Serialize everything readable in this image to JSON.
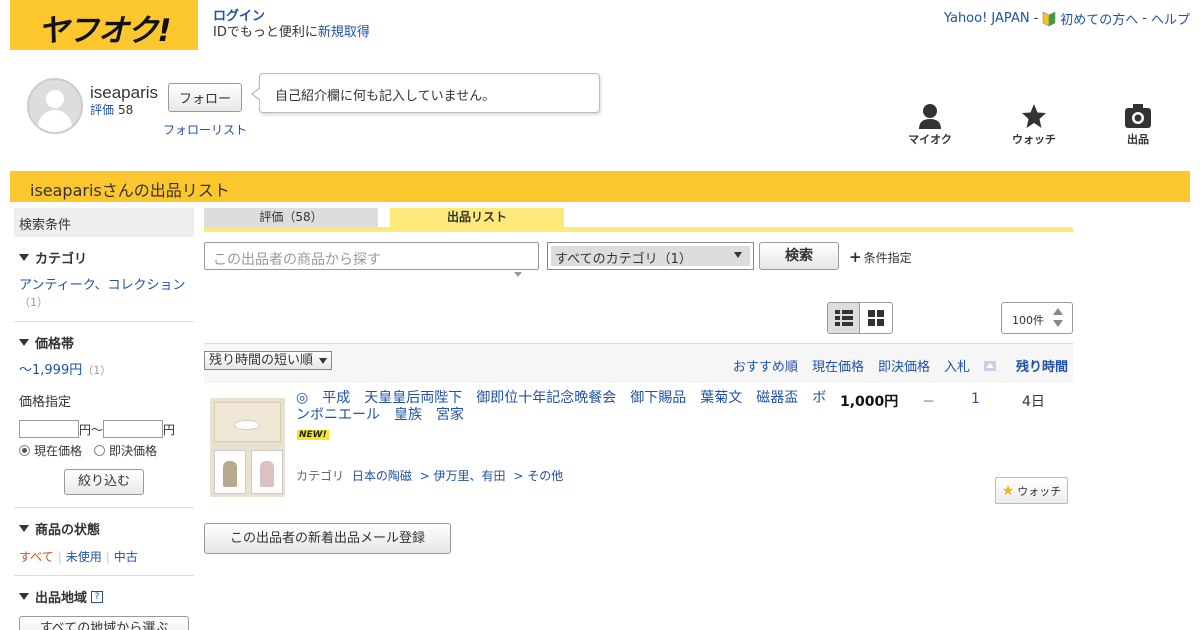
{
  "header": {
    "logo_text": "ヤフオク!",
    "login": "ログイン",
    "login_sub_prefix": "IDでもっと便利に",
    "signup": "新規取得",
    "links": [
      "Yahoo! JAPAN",
      "初めての方へ",
      "ヘルプ"
    ],
    "separator": "-"
  },
  "profile": {
    "username": "iseaparis",
    "rating_label": "評価",
    "rating_value": "58",
    "follow_button": "フォロー",
    "follow_list": "フォローリスト",
    "bio": "自己紹介欄に何も記入していません。"
  },
  "shortcuts": {
    "myauction": "マイオク",
    "watch": "ウォッチ",
    "sell": "出品"
  },
  "title_bar": "iseaparisさんの出品リスト",
  "sidebar": {
    "heading": "検索条件",
    "category_title": "カテゴリ",
    "category_item": "アンティーク、コレクション",
    "category_count": "（1）",
    "price_title": "価格帯",
    "price_range": "〜1,999円",
    "price_count": "（1）",
    "price_spec_label": "価格指定",
    "yen_tilde": "円～",
    "yen": "円",
    "radio_current": "現在価格",
    "radio_buynow": "即決価格",
    "narrow_button": "絞り込む",
    "condition_title": "商品の状態",
    "condition_options": [
      "すべて",
      "未使用",
      "中古"
    ],
    "region_title": "出品地域",
    "region_help": "?",
    "region_button": "すべての地域から選ぶ"
  },
  "tabs": {
    "evaluation": "評価（58）",
    "listing": "出品リスト"
  },
  "search": {
    "placeholder": "この出品者の商品から探す",
    "category_select": "すべてのカテゴリ（1）",
    "button": "検索",
    "condition_spec": "条件指定",
    "condition_plus": "+"
  },
  "per_page": "100件",
  "sort": {
    "select": "残り時間の短い順",
    "links": [
      "おすすめ順",
      "現在価格",
      "即決価格",
      "入札"
    ],
    "active": "残り時間"
  },
  "item": {
    "title": "◎　平成　天皇皇后両陛下　御即位十年記念晩餐会　御下賜品　葉菊文　磁器盃　ボンボニエール　皇族　宮家",
    "badge": "NEW!",
    "category_label": "カテゴリ",
    "category_path": [
      "日本の陶磁",
      "> 伊万里、有田",
      "> その他"
    ],
    "price": "1,000円",
    "buynow": "－",
    "bids": "1",
    "time_left": "4日",
    "watch_button": "ウォッチ"
  },
  "mail_button": "この出品者の新着出品メール登録",
  "colors": {
    "brand_yellow": "#fcc72e",
    "link_blue": "#1f51a8",
    "tab_yellow": "#fde97a"
  }
}
